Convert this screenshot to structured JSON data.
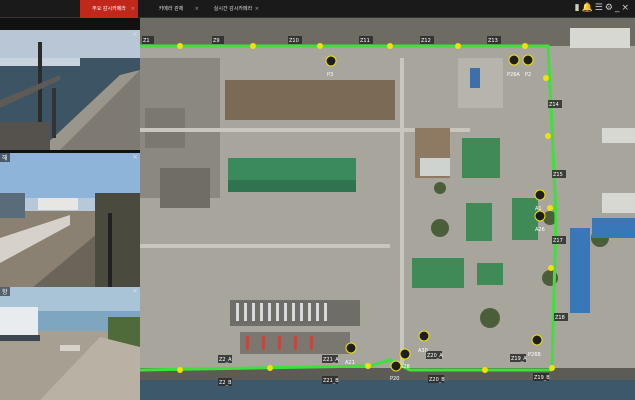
{
  "tabs": [
    {
      "label": "주요 감시카메라",
      "active": true
    },
    {
      "label": "카메라 관제",
      "active": false
    },
    {
      "label": "실시간 감시카메라",
      "active": false
    }
  ],
  "tab_close_glyph": "×",
  "top_icons": [
    "battery-icon",
    "bell-icon",
    "menu-icon",
    "gear-icon",
    "minimize-icon",
    "close-icon"
  ],
  "cameras": [
    {
      "label": "",
      "close": "×"
    },
    {
      "label": "해",
      "close": "×"
    },
    {
      "label": "항",
      "close": "×"
    }
  ],
  "zones": [
    {
      "label": "Z1"
    },
    {
      "label": "Z9"
    },
    {
      "label": "Z10"
    },
    {
      "label": "Z11"
    },
    {
      "label": "Z12"
    },
    {
      "label": "Z13"
    },
    {
      "label": "Z14"
    },
    {
      "label": "Z15"
    },
    {
      "label": "Z16"
    },
    {
      "label": "Z17"
    },
    {
      "label": "Z18"
    },
    {
      "label": "Z19_A"
    },
    {
      "label": "Z19_B"
    },
    {
      "label": "Z20_A"
    },
    {
      "label": "Z20_B"
    },
    {
      "label": "Z21_A"
    },
    {
      "label": "Z21_B"
    },
    {
      "label": "Z2_A"
    },
    {
      "label": "Z2_B"
    }
  ],
  "markers": [
    {
      "label": "P3"
    },
    {
      "label": "P26A"
    },
    {
      "label": "P2"
    },
    {
      "label": "A1"
    },
    {
      "label": "A22"
    },
    {
      "label": "A26"
    },
    {
      "label": "P26B"
    },
    {
      "label": "P1"
    },
    {
      "label": "A21"
    },
    {
      "label": "A20"
    },
    {
      "label": "A30"
    },
    {
      "label": "A28"
    },
    {
      "label": "P20"
    }
  ],
  "colors": {
    "accent": "#c1271b",
    "fence": "#3ee03a",
    "sensor": "#f2e00a"
  }
}
